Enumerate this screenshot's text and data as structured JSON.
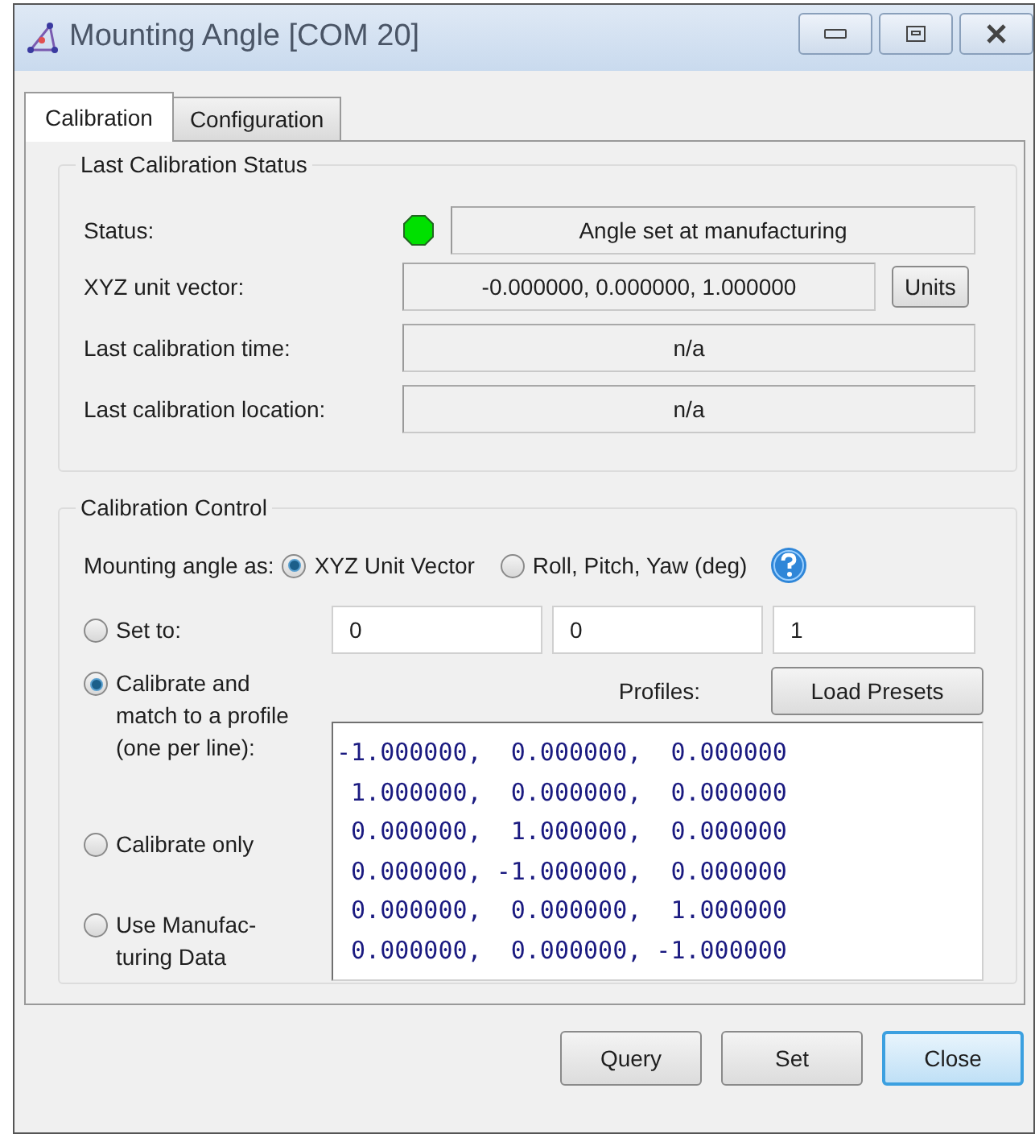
{
  "window": {
    "title": "Mounting Angle [COM 20]"
  },
  "tabs": [
    {
      "label": "Calibration",
      "selected": true
    },
    {
      "label": "Configuration",
      "selected": false
    }
  ],
  "status_group": {
    "title": "Last Calibration Status",
    "status": {
      "label": "Status:",
      "color": "#00e000",
      "value": "Angle set at manufacturing"
    },
    "vector": {
      "label": "XYZ unit vector:",
      "value": "-0.000000, 0.000000, 1.000000",
      "button": "Units"
    },
    "time": {
      "label": "Last calibration time:",
      "value": "n/a"
    },
    "location": {
      "label": "Last calibration location:",
      "value": "n/a"
    }
  },
  "control_group": {
    "title": "Calibration Control",
    "angle_label": "Mounting angle as:",
    "angle_options": [
      {
        "label": "XYZ Unit Vector",
        "selected": true
      },
      {
        "label": "Roll, Pitch, Yaw (deg)",
        "selected": false
      }
    ],
    "modes": [
      {
        "label": "Set to:",
        "selected": false
      },
      {
        "label": "Calibrate and match to a profile (one per line):",
        "selected": true
      },
      {
        "label": "Calibrate only",
        "selected": false
      },
      {
        "label": "Use Manufac-\nturing Data",
        "selected": false
      }
    ],
    "set_values": [
      "0",
      "0",
      "1"
    ],
    "profiles_label": "Profiles:",
    "load_button": "Load Presets",
    "profiles": [
      "-1.000000,  0.000000,  0.000000",
      " 1.000000,  0.000000,  0.000000",
      " 0.000000,  1.000000,  0.000000",
      " 0.000000, -1.000000,  0.000000",
      " 0.000000,  0.000000,  1.000000",
      " 0.000000,  0.000000, -1.000000"
    ]
  },
  "buttons": [
    {
      "label": "Query",
      "focused": false
    },
    {
      "label": "Set",
      "focused": false
    },
    {
      "label": "Close",
      "focused": true
    }
  ]
}
